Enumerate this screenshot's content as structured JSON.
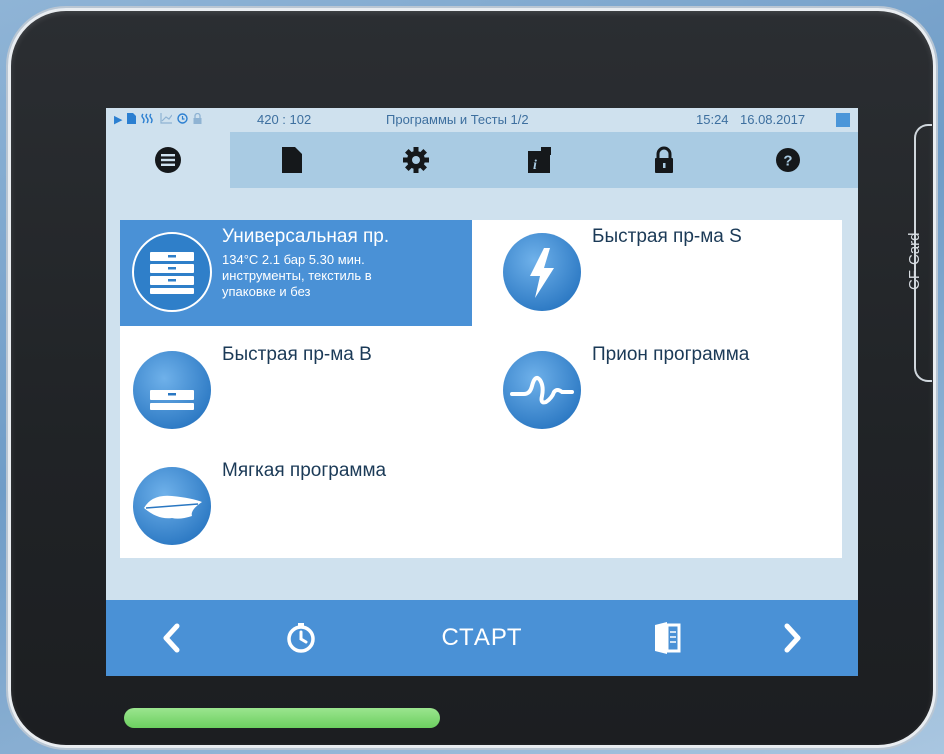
{
  "status_bar": {
    "icons": [
      "play-icon",
      "document-icon",
      "heat-icon",
      "chart-icon",
      "clock-icon",
      "lock-icon"
    ],
    "counter": "420 : 102",
    "screen_title": "Программы и Тесты 1/2",
    "time": "15:24",
    "date": "16.08.2017"
  },
  "tabs": [
    {
      "icon": "list-icon",
      "active": true
    },
    {
      "icon": "document-icon",
      "active": false
    },
    {
      "icon": "gear-icon",
      "active": false
    },
    {
      "icon": "info-box-icon",
      "active": false
    },
    {
      "icon": "lock-icon",
      "active": false
    },
    {
      "icon": "help-icon",
      "active": false
    }
  ],
  "programs": [
    {
      "title": "Универсальная пр.",
      "desc_line1": "134°C 2.1 бар 5.30 мин.",
      "desc_line2": "инструменты, текстиль в",
      "desc_line3": "упаковке и без",
      "icon": "stacked-trays-icon",
      "selected": true
    },
    {
      "title": "Быстрая пр-ма S",
      "icon": "lightning-icon",
      "selected": false
    },
    {
      "title": "Быстрая пр-ма B",
      "icon": "trays-icon",
      "selected": false
    },
    {
      "title": "Прион программа",
      "icon": "wave-icon",
      "selected": false
    },
    {
      "title": "Мягкая программа",
      "icon": "feather-icon",
      "selected": false
    }
  ],
  "bottom_bar": {
    "start_label": "СТАРТ",
    "icons": [
      "chevron-left-icon",
      "timer-icon",
      "door-icon",
      "chevron-right-icon"
    ]
  },
  "device": {
    "side_label": "CF-Card"
  },
  "colors": {
    "accent": "#4a91d6",
    "tabbar": "#a9cbe3",
    "screen_bg": "#cfe1ee",
    "status_text": "#3d6f9f",
    "led_green": "#6ccf5f"
  }
}
